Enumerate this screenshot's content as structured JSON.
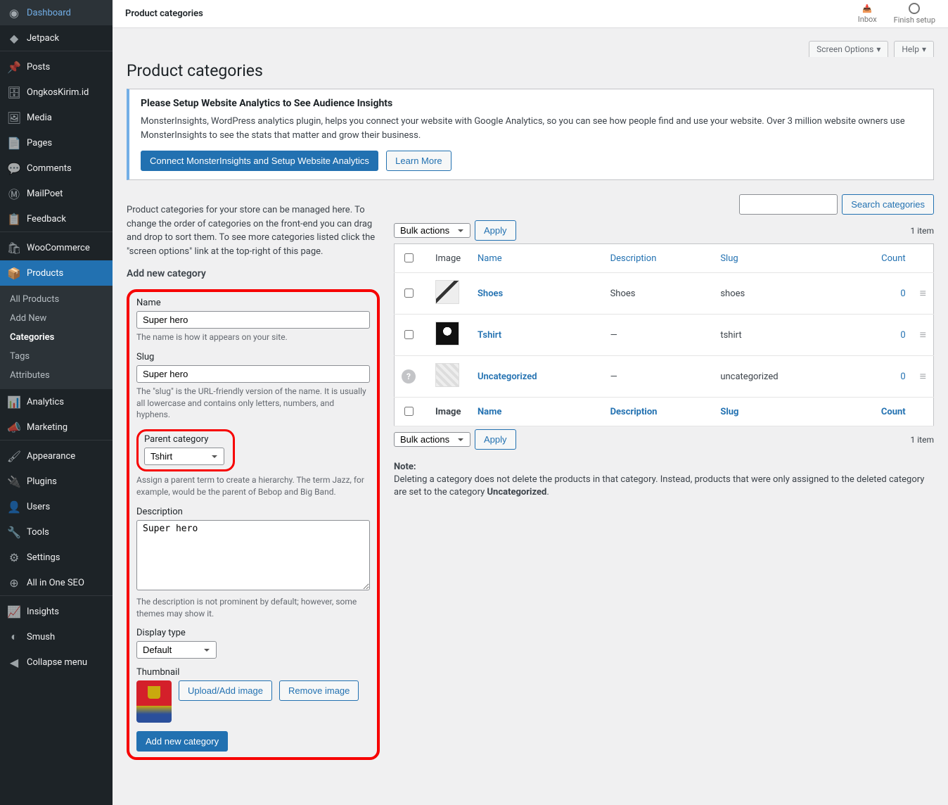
{
  "sidebar": {
    "items": [
      {
        "label": "Dashboard"
      },
      {
        "label": "Jetpack"
      },
      {
        "label": "Posts"
      },
      {
        "label": "OngkosKirim.id"
      },
      {
        "label": "Media"
      },
      {
        "label": "Pages"
      },
      {
        "label": "Comments"
      },
      {
        "label": "MailPoet"
      },
      {
        "label": "Feedback"
      },
      {
        "label": "WooCommerce"
      },
      {
        "label": "Products"
      },
      {
        "label": "Analytics"
      },
      {
        "label": "Marketing"
      },
      {
        "label": "Appearance"
      },
      {
        "label": "Plugins"
      },
      {
        "label": "Users"
      },
      {
        "label": "Tools"
      },
      {
        "label": "Settings"
      },
      {
        "label": "All in One SEO"
      },
      {
        "label": "Insights"
      },
      {
        "label": "Smush"
      },
      {
        "label": "Collapse menu"
      }
    ],
    "sub": [
      {
        "label": "All Products"
      },
      {
        "label": "Add New"
      },
      {
        "label": "Categories"
      },
      {
        "label": "Tags"
      },
      {
        "label": "Attributes"
      }
    ]
  },
  "topbar": {
    "title": "Product categories",
    "inbox": "Inbox",
    "finish": "Finish setup"
  },
  "tabs": {
    "screen": "Screen Options",
    "help": "Help"
  },
  "page_title": "Product categories",
  "notice": {
    "heading": "Please Setup Website Analytics to See Audience Insights",
    "text": "MonsterInsights, WordPress analytics plugin, helps you connect your website with Google Analytics, so you can see how people find and use your website. Over 3 million website owners use MonsterInsights to see the stats that matter and grow their business.",
    "btn_primary": "Connect MonsterInsights and Setup Website Analytics",
    "btn_secondary": "Learn More"
  },
  "intro": "Product categories for your store can be managed here. To change the order of categories on the front-end you can drag and drop to sort them. To see more categories listed click the \"screen options\" link at the top-right of this page.",
  "form": {
    "title": "Add new category",
    "name": {
      "label": "Name",
      "value": "Super hero",
      "desc": "The name is how it appears on your site."
    },
    "slug": {
      "label": "Slug",
      "value": "Super hero",
      "desc": "The \"slug\" is the URL-friendly version of the name. It is usually all lowercase and contains only letters, numbers, and hyphens."
    },
    "parent": {
      "label": "Parent category",
      "value": "Tshirt",
      "desc": "Assign a parent term to create a hierarchy. The term Jazz, for example, would be the parent of Bebop and Big Band."
    },
    "description": {
      "label": "Description",
      "value": "Super hero",
      "desc": "The description is not prominent by default; however, some themes may show it."
    },
    "display": {
      "label": "Display type",
      "value": "Default"
    },
    "thumbnail": {
      "label": "Thumbnail",
      "upload": "Upload/Add image",
      "remove": "Remove image"
    },
    "submit": "Add new category"
  },
  "list": {
    "search_btn": "Search categories",
    "bulk": "Bulk actions",
    "apply": "Apply",
    "count_text": "1 item",
    "cols": {
      "image": "Image",
      "name": "Name",
      "description": "Description",
      "slug": "Slug",
      "count": "Count"
    },
    "rows": [
      {
        "name": "Shoes",
        "description": "Shoes",
        "slug": "shoes",
        "count": "0"
      },
      {
        "name": "Tshirt",
        "description": "—",
        "slug": "tshirt",
        "count": "0"
      },
      {
        "name": "Uncategorized",
        "description": "—",
        "slug": "uncategorized",
        "count": "0"
      }
    ]
  },
  "note": {
    "label": "Note:",
    "text_a": "Deleting a category does not delete the products in that category. Instead, products that were only assigned to the deleted category are set to the category ",
    "bold": "Uncategorized",
    "text_b": "."
  }
}
